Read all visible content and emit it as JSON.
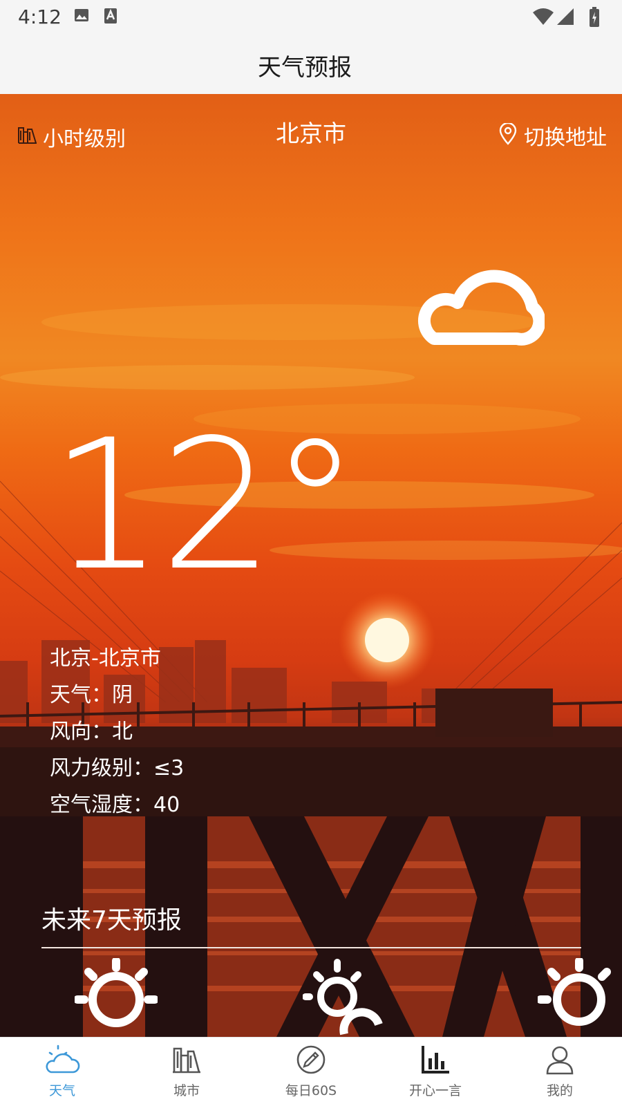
{
  "status_bar": {
    "time": "4:12"
  },
  "app_bar": {
    "title": "天气预报"
  },
  "hero": {
    "hourly_label": "小时级别",
    "city": "北京市",
    "switch_label": "切换地址",
    "current_weather_icon": "cloud-icon",
    "temperature": "12°"
  },
  "info": {
    "location": "北京-北京市",
    "weather": "天气：阴",
    "wind_direction": "风向：北",
    "wind_level": "风力级别：≤3",
    "humidity": "空气湿度：40"
  },
  "forecast": {
    "title": "未来7天预报",
    "icons": [
      "sun-icon",
      "partly-sunny-icon",
      "sun-icon"
    ]
  },
  "bottom_nav": {
    "items": [
      {
        "label": "天气",
        "icon": "weather-icon",
        "active": true
      },
      {
        "label": "城市",
        "icon": "city-icon",
        "active": false
      },
      {
        "label": "每日60S",
        "icon": "pencil-circle-icon",
        "active": false
      },
      {
        "label": "开心一言",
        "icon": "bar-chart-icon",
        "active": false
      },
      {
        "label": "我的",
        "icon": "user-icon",
        "active": false
      }
    ],
    "active_color": "#3d98d8"
  }
}
